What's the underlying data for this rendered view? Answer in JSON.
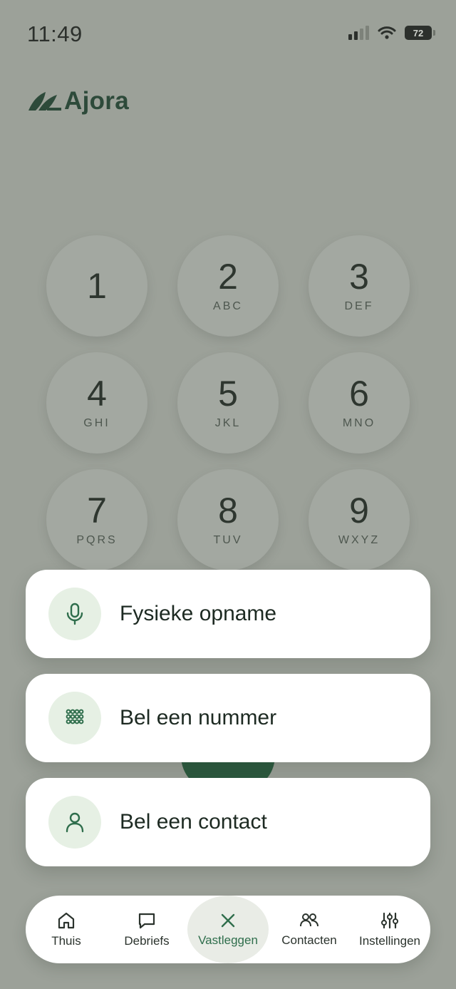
{
  "status_bar": {
    "time": "11:49",
    "battery": "72"
  },
  "brand": {
    "name": "Ajora"
  },
  "keypad": [
    {
      "digit": "1",
      "letters": ""
    },
    {
      "digit": "2",
      "letters": "ABC"
    },
    {
      "digit": "3",
      "letters": "DEF"
    },
    {
      "digit": "4",
      "letters": "GHI"
    },
    {
      "digit": "5",
      "letters": "JKL"
    },
    {
      "digit": "6",
      "letters": "MNO"
    },
    {
      "digit": "7",
      "letters": "PQRS"
    },
    {
      "digit": "8",
      "letters": "TUV"
    },
    {
      "digit": "9",
      "letters": "WXYZ"
    }
  ],
  "actions": [
    {
      "label": "Fysieke opname",
      "icon": "microphone-icon"
    },
    {
      "label": "Bel een nummer",
      "icon": "dialpad-icon"
    },
    {
      "label": "Bel een contact",
      "icon": "person-icon"
    }
  ],
  "nav": {
    "items": [
      {
        "label": "Thuis",
        "icon": "home-icon"
      },
      {
        "label": "Debriefs",
        "icon": "chat-icon"
      },
      {
        "label": "Vastleggen",
        "icon": "close-icon",
        "active": true
      },
      {
        "label": "Contacten",
        "icon": "people-icon"
      },
      {
        "label": "Instellingen",
        "icon": "sliders-icon"
      }
    ]
  },
  "colors": {
    "accent": "#2f6e4c",
    "brand": "#2d4a3a",
    "overlay": "#9ca199"
  }
}
